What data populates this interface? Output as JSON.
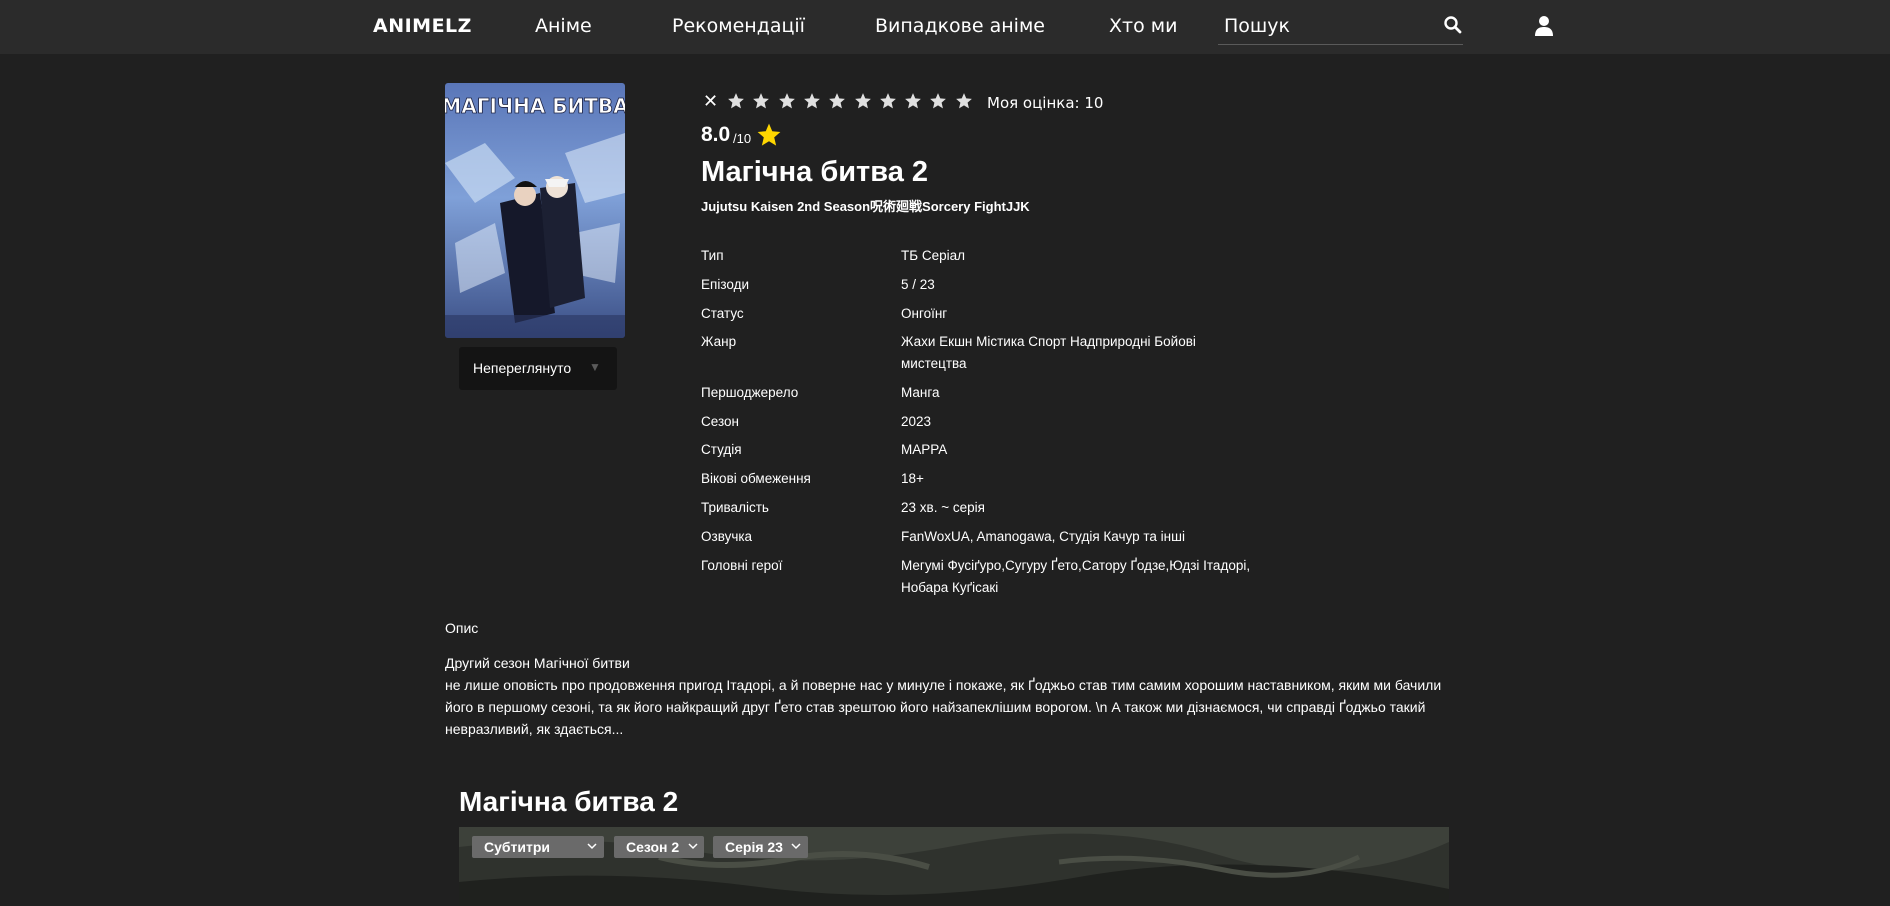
{
  "nav": {
    "logo": "ANIMELZ",
    "links": [
      "Аніме",
      "Рекомендації",
      "Випадкове аніме",
      "Хто ми"
    ],
    "search_placeholder": "Пошук"
  },
  "poster": {
    "title_text": "МАГІЧНА БИТВА",
    "watch_status": "Непереглянуто"
  },
  "rating": {
    "clear": "✕",
    "stars_count": 10,
    "my_score_label": "Моя оцінка: 10",
    "score": "8.0",
    "score_max": "/10"
  },
  "anime": {
    "title": "Магічна битва 2",
    "alt_names": "Jujutsu Kaisen 2nd Season呪術廻戦Sorcery FightJJK"
  },
  "info": [
    {
      "key": "Тип",
      "value": "ТБ Серіал"
    },
    {
      "key": "Епізоди",
      "value": "5 / 23"
    },
    {
      "key": "Статус",
      "value": "Онгоїнг"
    },
    {
      "key": "Жанр",
      "value": "Жахи Екшн Містика Спорт Надприродні Бойові мистецтва"
    },
    {
      "key": "Першоджерело",
      "value": "Манга"
    },
    {
      "key": "Сезон",
      "value": "2023"
    },
    {
      "key": "Студія",
      "value": "MAPPA"
    },
    {
      "key": "Вікові обмеження",
      "value": "18+"
    },
    {
      "key": "Тривалість",
      "value": "23 хв. ~ серія"
    },
    {
      "key": "Озвучка",
      "value": "FanWoxUA, Amanogawa, Студія Качур та інші"
    },
    {
      "key": "Головні герої",
      "value": "Мегумі Фусіґуро,Сугуру Ґето,Сатору Ґодзе,Юдзі Ітадорі, Нобара Куґісакі"
    }
  ],
  "description": {
    "heading": "Опис",
    "lead": "Другий сезон Магічної битви",
    "text": "не лише оповість про продовження пригод Ітадорі, а й поверне нас у минуле і покаже, як Ґоджьо став тим самим хорошим наставником, яким ми бачили його в першому сезоні, та як його найкращий друг Ґето став зрештою його найзапеклішим ворогом. \\n А також ми дізнаємося, чи справді Ґоджьо такий невразливий, як здається..."
  },
  "player": {
    "title": "Магічна битва 2",
    "selects": [
      "Субтитри",
      "Сезон 2",
      "Серія 23"
    ]
  },
  "colors": {
    "background": "#202020",
    "topbar": "#2b2b2b",
    "star_active": "#ffd700",
    "star_inactive": "#e0e0e0"
  }
}
